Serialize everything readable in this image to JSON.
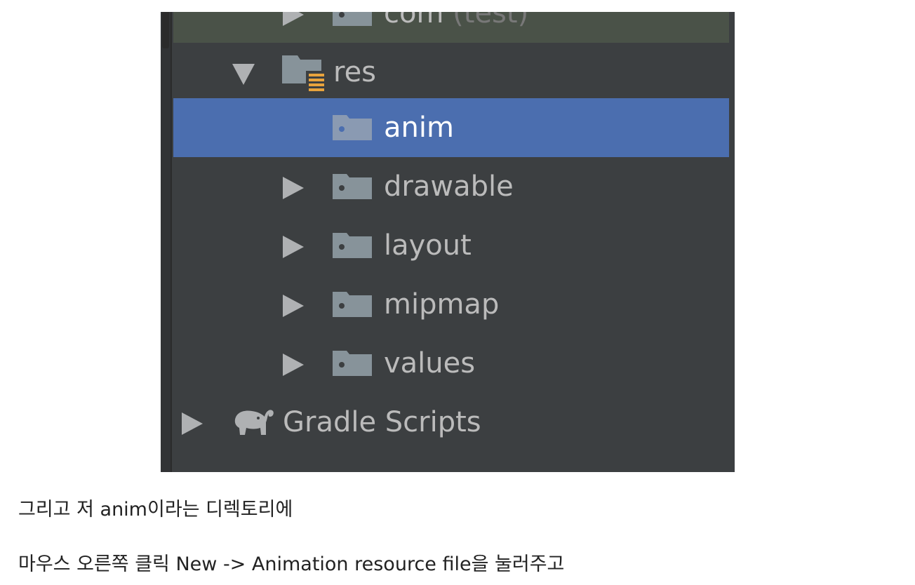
{
  "project_tree": {
    "rows": [
      {
        "label": "com",
        "sub_label": "(test)",
        "state": "collapsed"
      },
      {
        "label": "res",
        "state": "expanded"
      },
      {
        "label": "anim",
        "state": "selected"
      },
      {
        "label": "drawable",
        "state": "collapsed"
      },
      {
        "label": "layout",
        "state": "collapsed"
      },
      {
        "label": "mipmap",
        "state": "collapsed"
      },
      {
        "label": "values",
        "state": "collapsed"
      },
      {
        "label": "Gradle Scripts",
        "state": "collapsed"
      }
    ],
    "icons": {
      "folder": "folder-icon",
      "resource_folder": "resource-folder-icon",
      "gradle": "gradle-elephant-icon"
    },
    "colors": {
      "background": "#3c3f41",
      "selection": "#4b6eaf",
      "vcs_highlight": "#4a5248",
      "text": "#bbbbbb",
      "resource_badge": "#e8a33d"
    }
  },
  "caption": {
    "line1": "그리고 저 anim이라는 디렉토리에",
    "line2": "마우스 오른쪽 클릭  New -> Animation resource file을 눌러주고"
  }
}
